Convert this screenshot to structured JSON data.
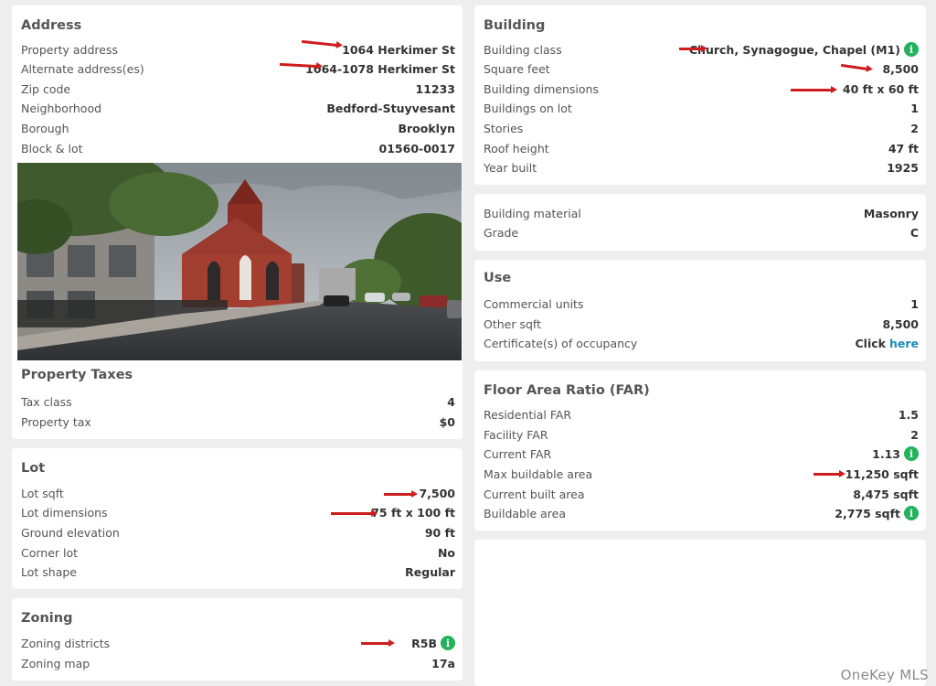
{
  "address": {
    "title": "Address",
    "rows": [
      {
        "label": "Property address",
        "value": "1064 Herkimer St"
      },
      {
        "label": "Alternate address(es)",
        "value": "1064-1078 Herkimer St"
      },
      {
        "label": "Zip code",
        "value": "11233"
      },
      {
        "label": "Neighborhood",
        "value": "Bedford-Stuyvesant"
      },
      {
        "label": "Borough",
        "value": "Brooklyn"
      },
      {
        "label": "Block & lot",
        "value": "01560-0017"
      }
    ]
  },
  "taxes": {
    "title": "Property Taxes",
    "rows": [
      {
        "label": "Tax class",
        "value": "4"
      },
      {
        "label": "Property tax",
        "value": "$0"
      }
    ]
  },
  "lot": {
    "title": "Lot",
    "rows": [
      {
        "label": "Lot sqft",
        "value": "7,500"
      },
      {
        "label": "Lot dimensions",
        "value": "75 ft x 100 ft"
      },
      {
        "label": "Ground elevation",
        "value": "90 ft"
      },
      {
        "label": "Corner lot",
        "value": "No"
      },
      {
        "label": "Lot shape",
        "value": "Regular"
      }
    ]
  },
  "zoning": {
    "title": "Zoning",
    "rows": [
      {
        "label": "Zoning districts",
        "value": "R5B"
      },
      {
        "label": "Zoning map",
        "value": "17a"
      }
    ]
  },
  "building": {
    "title": "Building",
    "rows": [
      {
        "label": "Building class",
        "value": "Church, Synagogue, Chapel (M1)"
      },
      {
        "label": "Square feet",
        "value": "8,500"
      },
      {
        "label": "Building dimensions",
        "value": "40 ft x 60 ft"
      },
      {
        "label": "Buildings on lot",
        "value": "1"
      },
      {
        "label": "Stories",
        "value": "2"
      },
      {
        "label": "Roof height",
        "value": "47 ft"
      },
      {
        "label": "Year built",
        "value": "1925"
      }
    ]
  },
  "material": {
    "rows": [
      {
        "label": "Building material",
        "value": "Masonry"
      },
      {
        "label": "Grade",
        "value": "C"
      }
    ]
  },
  "use": {
    "title": "Use",
    "rows": [
      {
        "label": "Commercial units",
        "value": "1"
      },
      {
        "label": "Other sqft",
        "value": "8,500"
      },
      {
        "label": "Certificate(s) of occupancy",
        "value_prefix": "Click",
        "link": "here"
      }
    ]
  },
  "far": {
    "title": "Floor Area Ratio (FAR)",
    "rows": [
      {
        "label": "Residential FAR",
        "value": "1.5"
      },
      {
        "label": "Facility FAR",
        "value": "2"
      },
      {
        "label": "Current FAR",
        "value": "1.13"
      },
      {
        "label": "Max buildable area",
        "value": "11,250 sqft"
      },
      {
        "label": "Current built area",
        "value": "8,475 sqft"
      },
      {
        "label": "Buildable area",
        "value": "2,775 sqft"
      }
    ]
  },
  "info_glyph": "i",
  "watermark": "OneKey MLS",
  "colors": {
    "arrow": "#cf1d1d",
    "info": "#22b35b",
    "link": "#1f8ab8"
  }
}
